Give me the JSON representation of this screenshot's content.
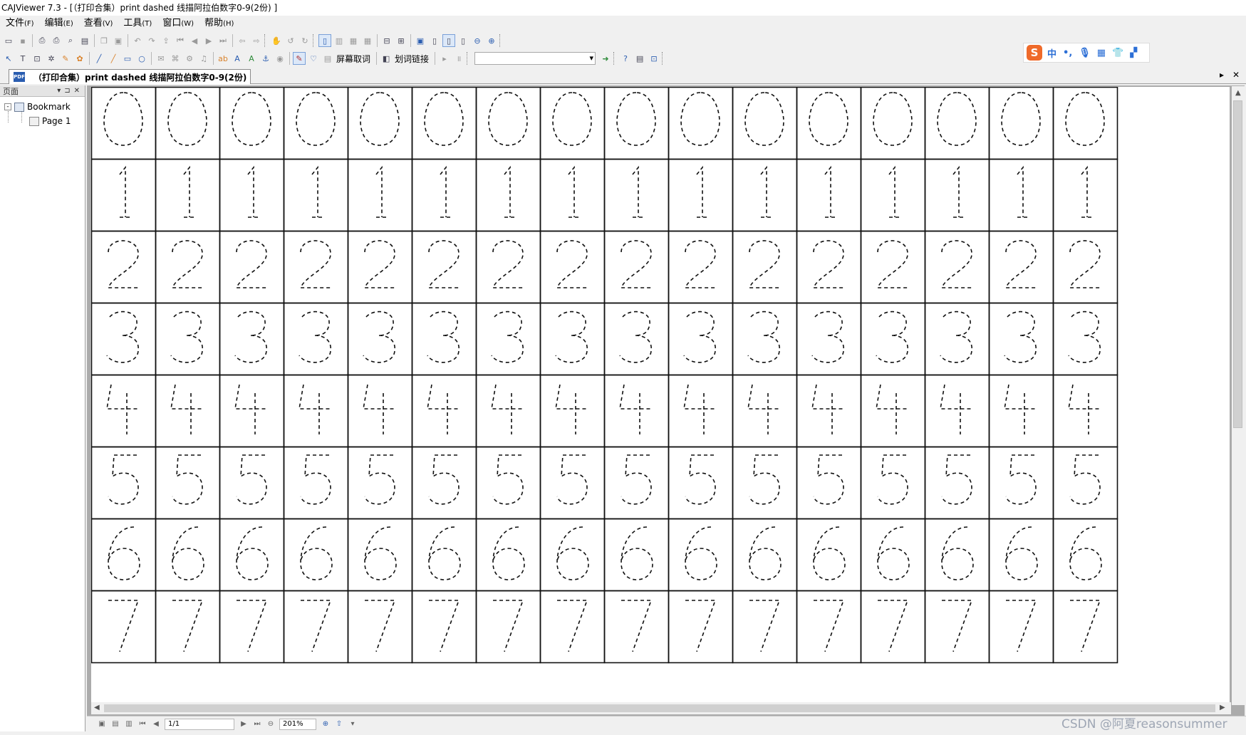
{
  "window": {
    "title": "CAJViewer 7.3 - [（打印合集）print dashed 线描阿拉伯数字0-9(2份) ]"
  },
  "menu": [
    {
      "label": "文件",
      "accel": "(F)"
    },
    {
      "label": "编辑",
      "accel": "(E)"
    },
    {
      "label": "查看",
      "accel": "(V)"
    },
    {
      "label": "工具",
      "accel": "(T)"
    },
    {
      "label": "窗口",
      "accel": "(W)"
    },
    {
      "label": "帮助",
      "accel": "(H)"
    }
  ],
  "toolbar": {
    "screen_capture_label": "屏幕取词",
    "word_link_label": "划词链接"
  },
  "ime": {
    "logo": "S",
    "mode": "中",
    "punct": "•,"
  },
  "tab": {
    "icon": "PDF",
    "title": "（打印合集）print dashed 线描阿拉伯数字0-9(2份)"
  },
  "side_panel": {
    "header": "页面",
    "tree": [
      {
        "label": "Bookmark",
        "expander": "-"
      },
      {
        "label": "Page 1"
      }
    ]
  },
  "document": {
    "columns": 16,
    "rows_visible": 8,
    "digits": [
      "0",
      "1",
      "2",
      "3",
      "4",
      "5",
      "6",
      "7"
    ]
  },
  "statusbar": {
    "page_indicator": "1/1",
    "zoom": "201%"
  },
  "watermark": "CSDN @阿夏reasonsummer"
}
